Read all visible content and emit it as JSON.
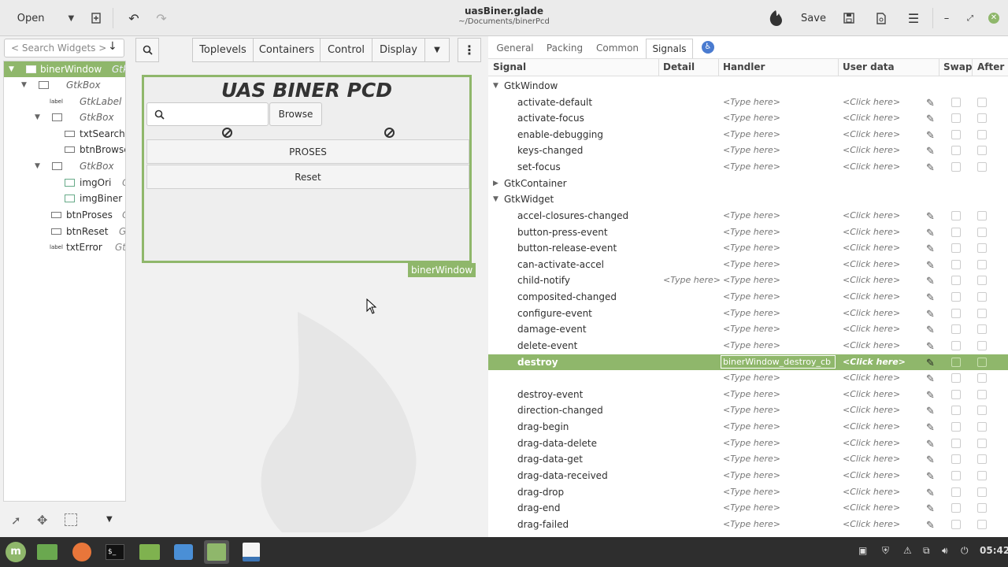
{
  "header": {
    "open_label": "Open",
    "save_label": "Save",
    "title": "uasBiner.glade",
    "subtitle": "~/Documents/binerPcd"
  },
  "left_panel": {
    "search_placeholder": "< Search Widgets >",
    "tree": [
      {
        "label": "binerWindow",
        "type": "Gtk",
        "level": 0,
        "selected": true
      },
      {
        "label": "GtkBox",
        "italic": true,
        "level": 1
      },
      {
        "label": "GtkLabel",
        "italic": true,
        "level": 2
      },
      {
        "label": "GtkBox",
        "italic": true,
        "level": 2
      },
      {
        "label": "txtSearch",
        "level": 3
      },
      {
        "label": "btnBrowse",
        "level": 3
      },
      {
        "label": "GtkBox",
        "italic": true,
        "level": 2
      },
      {
        "label": "imgOri",
        "type": "G",
        "level": 3
      },
      {
        "label": "imgBiner",
        "level": 3
      },
      {
        "label": "btnProses",
        "type": "G",
        "level": 2
      },
      {
        "label": "btnReset",
        "type": "G",
        "level": 2
      },
      {
        "label": "txtError",
        "type": "Gt",
        "level": 2
      }
    ]
  },
  "palette": {
    "toplevels": "Toplevels",
    "containers": "Containers",
    "control": "Control",
    "display": "Display"
  },
  "canvas": {
    "window_title": "UAS BINER PCD",
    "browse_label": "Browse",
    "proses_label": "PROSES",
    "reset_label": "Reset",
    "window_name": "binerWindow"
  },
  "inspector": {
    "tabs": [
      "General",
      "Packing",
      "Common",
      "Signals"
    ],
    "active_tab": "Signals",
    "columns": [
      "Signal",
      "Detail",
      "Handler",
      "User data",
      "Swap",
      "After"
    ],
    "type_here": "<Type here>",
    "click_here": "<Click here>",
    "groups": [
      {
        "name": "GtkWindow",
        "expanded": true,
        "signals": [
          "activate-default",
          "activate-focus",
          "enable-debugging",
          "keys-changed",
          "set-focus"
        ]
      },
      {
        "name": "GtkContainer",
        "expanded": false,
        "signals": []
      },
      {
        "name": "GtkWidget",
        "expanded": true,
        "signals": [
          "accel-closures-changed",
          "button-press-event",
          "button-release-event",
          "can-activate-accel",
          "child-notify",
          "composited-changed",
          "configure-event",
          "damage-event",
          "delete-event",
          "destroy",
          "",
          "destroy-event",
          "direction-changed",
          "drag-begin",
          "drag-data-delete",
          "drag-data-get",
          "drag-data-received",
          "drag-drop",
          "drag-end",
          "drag-failed"
        ]
      }
    ],
    "selected_signal": "destroy",
    "selected_handler": "binerWindow_destroy_cb"
  },
  "taskbar": {
    "clock": "05:42"
  },
  "colors": {
    "accent": "#8fb76b",
    "taskbar": "#2e2e2e"
  }
}
